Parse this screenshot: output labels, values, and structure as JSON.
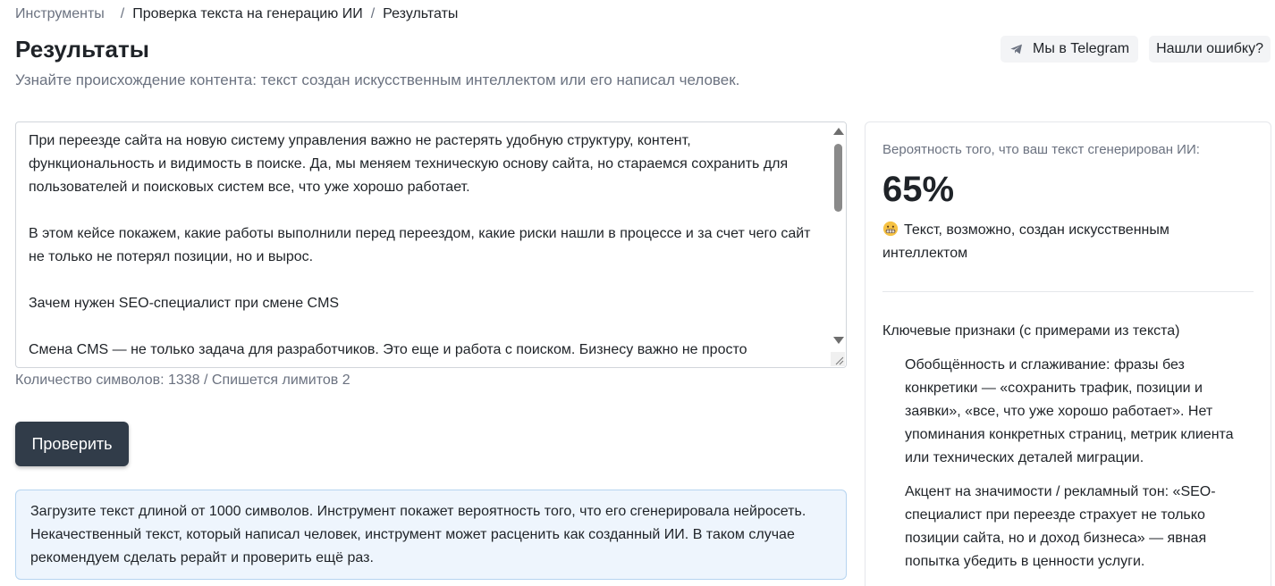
{
  "breadcrumb": {
    "root": "Инструменты",
    "separator": "/",
    "tool": "Проверка текста на генерацию ИИ",
    "current": "Результаты"
  },
  "header": {
    "title": "Результаты",
    "subtitle": "Узнайте происхождение контента: текст создан искусственным интеллектом или его написал человек.",
    "telegram_label": "Мы в Telegram",
    "telegram_icon": "telegram-plane-icon",
    "report_error_label": "Нашли ошибку?"
  },
  "editor": {
    "paragraphs": [
      "При переезде сайта на новую систему управления важно не растерять удобную структуру, контент, функциональность и видимость в поиске. Да, мы меняем техническую основу сайта, но стараемся сохранить для пользователей и поисковых систем все, что уже хорошо работает.",
      "В этом кейсе покажем, какие работы выполнили перед переездом, какие риски нашли в процессе и за счет чего сайт не только не потерял позиции, но и вырос.",
      "Зачем нужен SEO-специалист при смене CMS",
      "Смена CMS — не только задача для разработчиков. Это еще и работа с поиском. Бизнесу важно не просто"
    ],
    "char_count": "Количество символов: 1338 / Спишется лимитов 2"
  },
  "check_button_label": "Проверить",
  "info_text": "Загрузите текст длиной от 1000 символов. Инструмент покажет вероятность того, что его сгенерировала нейросеть. Некачественный текст, который написал человек, инструмент может расценить как созданный ИИ. В таком случае рекомендуем сделать рерайт и проверить ещё раз.",
  "result": {
    "probability_label": "Вероятность того, что ваш текст сгенерирован ИИ:",
    "probability_value": "65%",
    "verdict_icon": "grimacing-face-icon",
    "verdict_text": "Текст, возможно, создан искусственным интеллектом",
    "signs_title": "Ключевые признаки (с примерами из текста)",
    "signs": [
      "Обобщённость и сглаживание: фразы без конкретики — «сохранить трафик, позиции и заявки», «все, что уже хорошо работает». Нет упоминания конкретных страниц, метрик клиента или технических деталей миграции.",
      "Акцент на значимости / рекламный тон: «SEO-специалист при переезде страхует не только позиции сайта, но и доход бизнеса» — явная попытка убедить в ценности услуги."
    ]
  },
  "colors": {
    "primary_button": "#313c49",
    "info_bg": "#eef5fd",
    "info_border": "#b6d4f0",
    "muted_text": "#6b7280"
  }
}
